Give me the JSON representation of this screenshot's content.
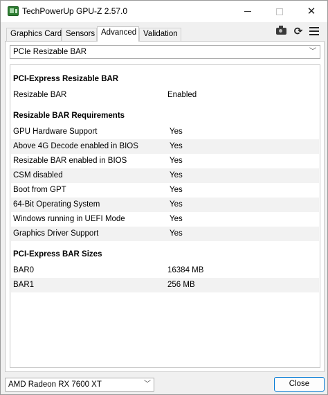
{
  "window": {
    "title": "TechPowerUp GPU-Z 2.57.0"
  },
  "tabs": [
    {
      "label": "Graphics Card"
    },
    {
      "label": "Sensors"
    },
    {
      "label": "Advanced"
    },
    {
      "label": "Validation"
    }
  ],
  "toolbar": {
    "icons": [
      "camera-icon",
      "refresh-icon",
      "menu-icon"
    ]
  },
  "category_select": {
    "value": "PCIe Resizable BAR"
  },
  "sections": [
    {
      "title": "PCI-Express Resizable BAR",
      "rows": [
        {
          "label": "Resizable BAR",
          "value": "Enabled"
        }
      ]
    },
    {
      "title": "Resizable BAR Requirements",
      "rows": [
        {
          "label": "GPU Hardware Support",
          "value": "Yes"
        },
        {
          "label": "Above 4G Decode enabled in BIOS",
          "value": "Yes"
        },
        {
          "label": "Resizable BAR enabled in BIOS",
          "value": "Yes"
        },
        {
          "label": "CSM disabled",
          "value": "Yes"
        },
        {
          "label": "Boot from GPT",
          "value": "Yes"
        },
        {
          "label": "64-Bit Operating System",
          "value": "Yes"
        },
        {
          "label": "Windows running in UEFI Mode",
          "value": "Yes"
        },
        {
          "label": "Graphics Driver Support",
          "value": "Yes"
        }
      ]
    },
    {
      "title": "PCI-Express BAR Sizes",
      "rows": [
        {
          "label": "BAR0",
          "value": "16384 MB"
        },
        {
          "label": "BAR1",
          "value": "256 MB"
        }
      ]
    }
  ],
  "gpu_select": {
    "value": "AMD Radeon RX 7600 XT"
  },
  "buttons": {
    "close": "Close"
  }
}
